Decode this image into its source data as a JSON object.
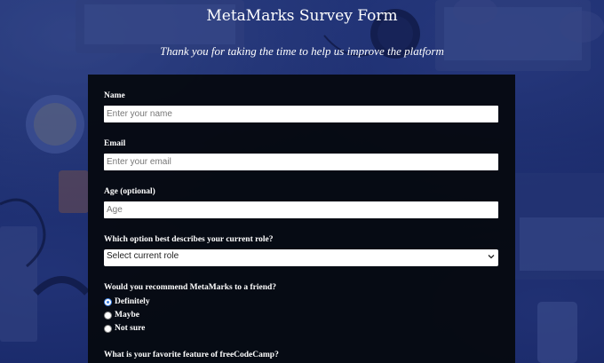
{
  "header": {
    "title": "MetaMarks Survey Form",
    "subtitle": "Thank you for taking the time to help us improve the platform"
  },
  "form": {
    "name": {
      "label": "Name",
      "placeholder": "Enter your name",
      "value": ""
    },
    "email": {
      "label": "Email",
      "placeholder": "Enter your email",
      "value": ""
    },
    "age": {
      "label": "Age (optional)",
      "placeholder": "Age",
      "value": ""
    },
    "role": {
      "label": "Which option best describes your current role?",
      "selected": "Select current role"
    },
    "recommend": {
      "label": "Would you recommend MetaMarks to a friend?",
      "options": [
        {
          "label": "Definitely",
          "checked": true
        },
        {
          "label": "Maybe",
          "checked": false
        },
        {
          "label": "Not sure",
          "checked": false
        }
      ]
    },
    "favorite": {
      "label": "What is your favorite feature of freeCodeCamp?"
    }
  },
  "colors": {
    "form_background": "#060a12",
    "background_tint": "#1b2a5a",
    "radio_checked": "#3b7de0"
  }
}
